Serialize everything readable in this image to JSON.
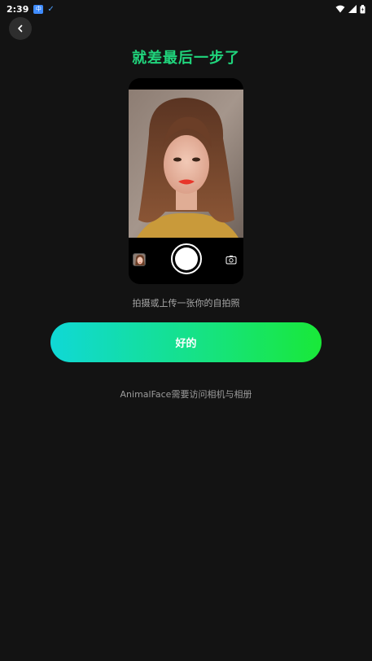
{
  "status_bar": {
    "time": "2:39",
    "app_icon_text": "中",
    "check_glyph": "✓",
    "icons": [
      "wifi-icon",
      "signal-icon",
      "battery-icon"
    ]
  },
  "header": {
    "back_icon": "chevron-left-icon",
    "title": "就差最后一步了"
  },
  "camera_preview": {
    "shutter_icon": "shutter-icon",
    "gallery_icon": "gallery-thumbnail",
    "flip_icon": "flip-camera-icon"
  },
  "instruction": "拍摄或上传一张你的自拍照",
  "primary_button": {
    "label": "好的"
  },
  "permission_note": "AnimalFace需要访问相机与相册",
  "colors": {
    "background": "#131313",
    "title": "#20d47c",
    "button_gradient_start": "#10d8d6",
    "button_gradient_end": "#19e838"
  }
}
